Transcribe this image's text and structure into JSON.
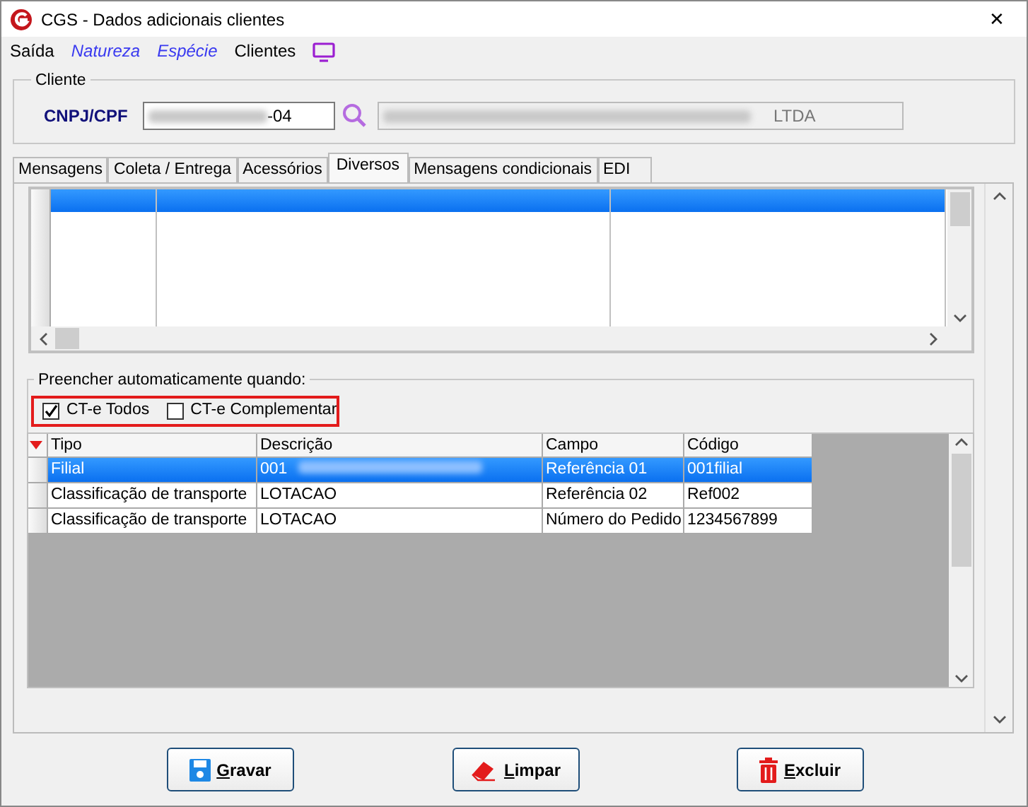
{
  "window": {
    "title": "CGS - Dados adicionais clientes",
    "close": "✕"
  },
  "menu": [
    {
      "label": "Saída",
      "kind": "plain"
    },
    {
      "label": "Natureza",
      "kind": "link"
    },
    {
      "label": "Espécie",
      "kind": "link"
    },
    {
      "label": "Clientes",
      "kind": "plain"
    }
  ],
  "cliente": {
    "legend": "Cliente",
    "label": "CNPJ/CPF",
    "cnpj_value": "-04",
    "name_value": "LTDA"
  },
  "tabs": [
    {
      "label": "Mensagens",
      "selected": false
    },
    {
      "label": "Coleta / Entrega",
      "selected": false
    },
    {
      "label": "Acessórios",
      "selected": false
    },
    {
      "label": "Diversos",
      "selected": true
    },
    {
      "label": "Mensagens condicionais",
      "selected": false
    },
    {
      "label": "EDI",
      "selected": false
    }
  ],
  "upper_grid": {
    "rows": [
      {
        "selected": true
      }
    ]
  },
  "auto_fill": {
    "legend": "Preencher automaticamente quando:",
    "options": [
      {
        "label": "CT-e Todos",
        "checked": true
      },
      {
        "label": "CT-e Complementar",
        "checked": false
      }
    ]
  },
  "lower_grid": {
    "columns": [
      "Tipo",
      "Descrição",
      "Campo",
      "Código"
    ],
    "rows": [
      {
        "cells": [
          "Filial",
          "001",
          "Referência 01",
          "001filial"
        ],
        "selected": true
      },
      {
        "cells": [
          "Classificação de transporte",
          "LOTACAO",
          "Referência 02",
          "Ref002"
        ],
        "selected": false
      },
      {
        "cells": [
          "Classificação de transporte",
          "LOTACAO",
          "Número do Pedido",
          "1234567899"
        ],
        "selected": false
      }
    ]
  },
  "buttons": [
    {
      "label": "Gravar",
      "kind": "save"
    },
    {
      "label": "Limpar",
      "kind": "clear"
    },
    {
      "label": "Excluir",
      "kind": "delete"
    }
  ]
}
